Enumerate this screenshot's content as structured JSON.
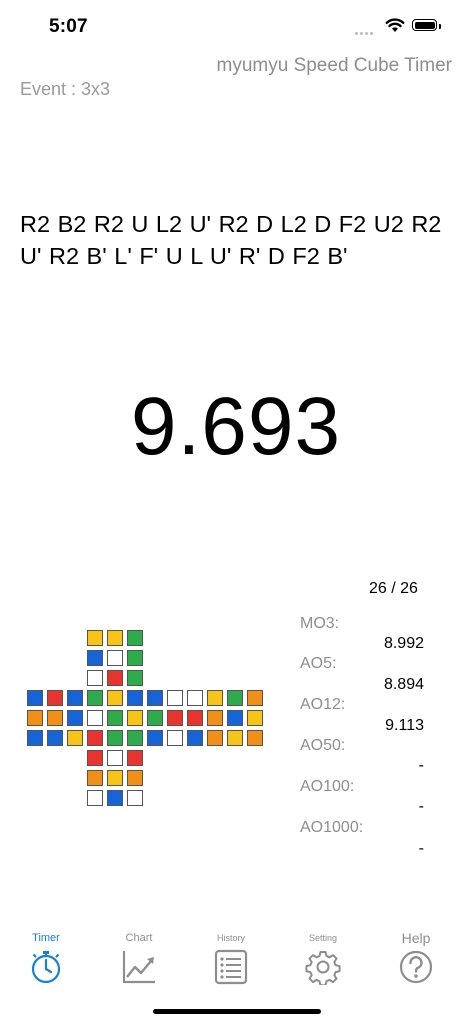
{
  "status_bar": {
    "time": "5:07"
  },
  "header": {
    "app_title": "myumyu Speed Cube Timer",
    "event": "Event : 3x3"
  },
  "scramble": "R2 B2 R2 U L2 U' R2 D L2 D F2 U2 R2 U' R2 B' L' F' U L U' R' D F2 B'",
  "timer": {
    "time": "9.693"
  },
  "cube": {
    "colors": {
      "W": "#ffffff",
      "Y": "#f7c518",
      "R": "#e8342e",
      "O": "#f28f16",
      "B": "#1565d8",
      "G": "#2eab4a"
    },
    "faces": {
      "U": [
        "Y",
        "Y",
        "G",
        "B",
        "W",
        "G",
        "W",
        "R",
        "G"
      ],
      "L": [
        "B",
        "R",
        "B",
        "O",
        "O",
        "B",
        "B",
        "B",
        "Y"
      ],
      "F": [
        "G",
        "Y",
        "B",
        "W",
        "G",
        "Y",
        "R",
        "G",
        "G"
      ],
      "R": [
        "B",
        "W",
        "W",
        "G",
        "R",
        "R",
        "B",
        "W",
        "B"
      ],
      "Bk": [
        "Y",
        "G",
        "O",
        "O",
        "B",
        "Y",
        "O",
        "Y",
        "O"
      ],
      "D": [
        "R",
        "W",
        "R",
        "O",
        "Y",
        "O",
        "W",
        "B",
        "W"
      ]
    }
  },
  "stats": {
    "count": "26 / 26",
    "items": [
      {
        "label": "MO3:",
        "value": "8.992"
      },
      {
        "label": "AO5:",
        "value": "8.894"
      },
      {
        "label": "AO12:",
        "value": "9.113"
      },
      {
        "label": "AO50:",
        "value": "-"
      },
      {
        "label": "AO100:",
        "value": "-"
      },
      {
        "label": "AO1000:",
        "value": "-"
      }
    ]
  },
  "tabs": [
    {
      "label": "Timer",
      "icon": "stopwatch-icon",
      "active": true
    },
    {
      "label": "Chart",
      "icon": "chart-icon",
      "active": false
    },
    {
      "label": "History",
      "icon": "list-icon",
      "active": false
    },
    {
      "label": "Setting",
      "icon": "gear-icon",
      "active": false
    },
    {
      "label": "Help",
      "icon": "help-icon",
      "active": false
    }
  ],
  "theme": {
    "accent": "#1a7fd6",
    "tab_inactive": "#8e8e8e"
  }
}
